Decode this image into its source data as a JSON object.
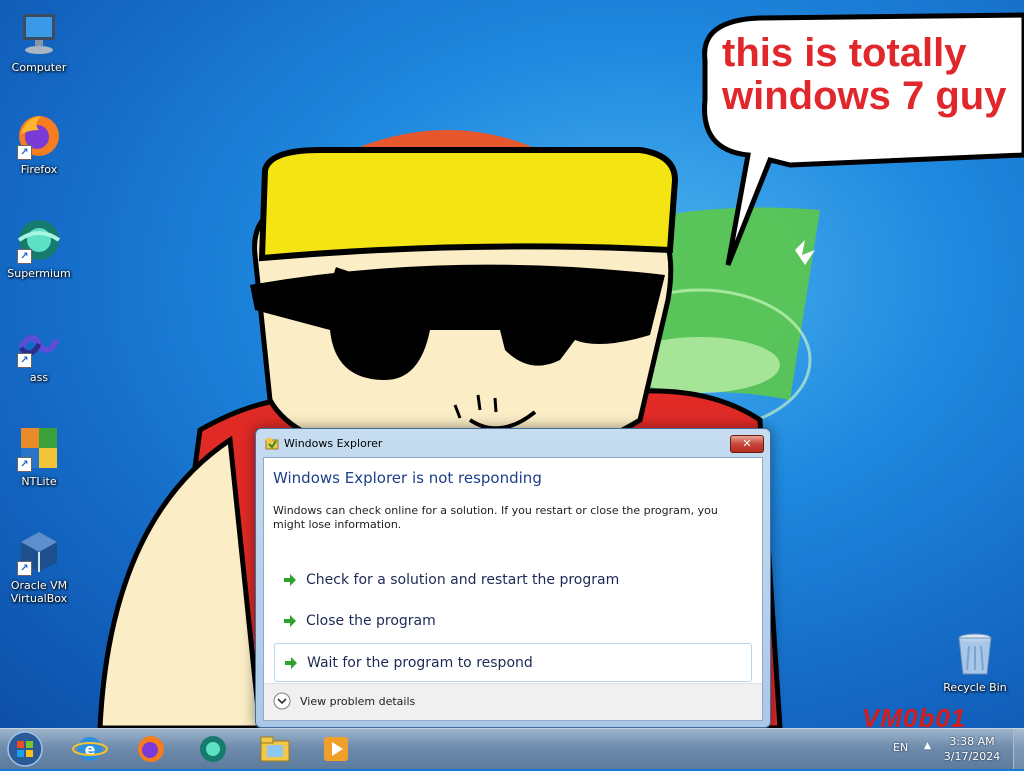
{
  "desktop_icons": [
    {
      "label": "Computer",
      "icon": "computer-icon"
    },
    {
      "label": "Firefox",
      "icon": "firefox-icon"
    },
    {
      "label": "Supermium",
      "icon": "supermium-icon"
    },
    {
      "label": "ass",
      "icon": "ass-app-icon"
    },
    {
      "label": "NTLite",
      "icon": "ntlite-icon"
    },
    {
      "label": "Oracle VM VirtualBox",
      "icon": "virtualbox-icon"
    },
    {
      "label": "Recycle Bin",
      "icon": "recycle-bin-icon"
    }
  ],
  "wallpaper": {
    "speech_text": "this is totally windows 7 guy",
    "watermark": "VM0b01"
  },
  "dialog": {
    "title": "Windows Explorer",
    "heading": "Windows Explorer is not responding",
    "description": "Windows can check online for a solution. If you restart or close the program, you might lose information.",
    "options": [
      {
        "label": "Check for a solution and restart the program"
      },
      {
        "label": "Close the program"
      },
      {
        "label": "Wait for the program to respond"
      }
    ],
    "details_label": "View problem details",
    "close_glyph": "✕"
  },
  "taskbar": {
    "pinned": [
      "internet-explorer-icon",
      "firefox-icon",
      "supermium-icon",
      "windows-explorer-icon",
      "media-player-icon"
    ],
    "language": "EN",
    "time": "3:38 AM",
    "date": "3/17/2024"
  },
  "colors": {
    "desktop_blue": "#1f8ae0",
    "dialog_heading": "#1d3f8a",
    "speech_red": "#e0272b",
    "arrow_green": "#2ea12e"
  }
}
